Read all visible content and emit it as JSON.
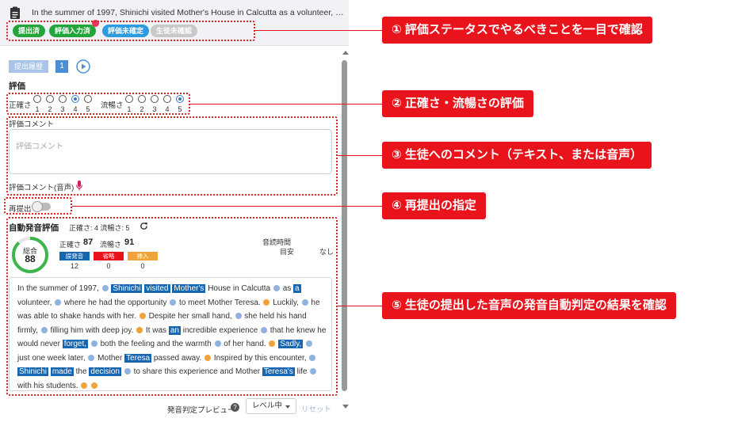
{
  "prompt": {
    "text": "In the summer of 1997, Shinichi visited Mother's House in Calcutta as a volunteer, whe..."
  },
  "status_tags": [
    {
      "label": "提出済",
      "color": "#22a63a"
    },
    {
      "label": "評価入力済",
      "color": "#22a63a"
    },
    {
      "label": "評価未確定",
      "color": "#2d9be0"
    },
    {
      "label": "生徒未確認",
      "color": "#c8c8c8"
    }
  ],
  "history": {
    "label": "提出履歴",
    "number": "1"
  },
  "evaluation": {
    "title": "評価",
    "accuracy_label": "正確さ",
    "fluency_label": "流暢さ",
    "scale": [
      "1",
      "2",
      "3",
      "4",
      "5"
    ],
    "accuracy_selected": 4,
    "fluency_selected": 5
  },
  "comment": {
    "label": "評価コメント",
    "placeholder": "評価コメント",
    "audio_label": "評価コメント(音声)"
  },
  "resubmit": {
    "label": "再提出",
    "enabled": false
  },
  "auto_eval": {
    "title": "自動発音評価",
    "summary": "正確さ: 4  流暢さ: 5",
    "total_label": "総合",
    "total": "88",
    "total_fraction": 0.88,
    "accuracy_label": "正確さ",
    "accuracy_score": "87",
    "fluency_label": "流暢さ",
    "fluency_score": "91",
    "reading_time_label": "音読時間",
    "target_label": "目安",
    "target_value": "なし",
    "badges": [
      {
        "label": "誤発音",
        "color": "#1666b0",
        "count": "12"
      },
      {
        "label": "省略",
        "color": "#e8131b",
        "count": "0"
      },
      {
        "label": "挿入",
        "color": "#f0a33a",
        "count": "0"
      }
    ]
  },
  "passage_lines": [
    [
      [
        "t",
        "In the summer of 1997,"
      ],
      [
        "b"
      ],
      [
        "h",
        "Shinichi"
      ],
      [
        "h",
        "visited"
      ],
      [
        "h",
        "Mother's"
      ],
      [
        "t",
        "House in Calcutta"
      ],
      [
        "b"
      ],
      [
        "t",
        "as"
      ],
      [
        "h",
        "a"
      ]
    ],
    [
      [
        "t",
        "volunteer,"
      ],
      [
        "b"
      ],
      [
        "t",
        "where he had the opportunity"
      ],
      [
        "b"
      ],
      [
        "t",
        "to meet Mother Teresa."
      ],
      [
        "o"
      ],
      [
        "t",
        "Luckily,"
      ],
      [
        "b"
      ],
      [
        "t",
        "he"
      ]
    ],
    [
      [
        "t",
        "was able to shake hands with her."
      ],
      [
        "o"
      ],
      [
        "t",
        "Despite her small hand,"
      ],
      [
        "b"
      ],
      [
        "t",
        "she held his hand"
      ]
    ],
    [
      [
        "t",
        "firmly,"
      ],
      [
        "b"
      ],
      [
        "t",
        "filling him with deep joy."
      ],
      [
        "o"
      ],
      [
        "t",
        "It was"
      ],
      [
        "h",
        "an"
      ],
      [
        "t",
        "incredible experience"
      ],
      [
        "b"
      ],
      [
        "t",
        "that he knew he"
      ]
    ],
    [
      [
        "t",
        "would never"
      ],
      [
        "h",
        "forget,"
      ],
      [
        "b"
      ],
      [
        "t",
        "both the feeling and the warmth"
      ],
      [
        "b"
      ],
      [
        "t",
        "of her hand."
      ],
      [
        "o"
      ],
      [
        "h",
        "Sadly,"
      ],
      [
        "b"
      ]
    ],
    [
      [
        "t",
        "just one week later,"
      ],
      [
        "b"
      ],
      [
        "t",
        "Mother"
      ],
      [
        "h",
        "Teresa"
      ],
      [
        "t",
        "passed away."
      ],
      [
        "o"
      ],
      [
        "t",
        "Inspired by this encounter,"
      ],
      [
        "b"
      ]
    ],
    [
      [
        "h",
        "Shinichi"
      ],
      [
        "h",
        "made"
      ],
      [
        "t",
        "the"
      ],
      [
        "h",
        "decision"
      ],
      [
        "b"
      ],
      [
        "t",
        "to share this experience and Mother"
      ],
      [
        "h",
        "Teresa's"
      ],
      [
        "t",
        "life"
      ],
      [
        "b"
      ]
    ],
    [
      [
        "t",
        "with his students."
      ],
      [
        "o"
      ],
      [
        "o"
      ]
    ]
  ],
  "preview": {
    "label": "発音判定プレビュー",
    "level": "レベル中",
    "reset": "リセット"
  },
  "callouts": [
    "① 評価ステータスでやるべきことを一目で確認",
    "② 正確さ・流暢さの評価",
    "③ 生徒へのコメント（テキスト、または音声）",
    "④ 再提出の指定",
    "⑤ 生徒の提出した音声の発音自動判定の結果を確認"
  ]
}
